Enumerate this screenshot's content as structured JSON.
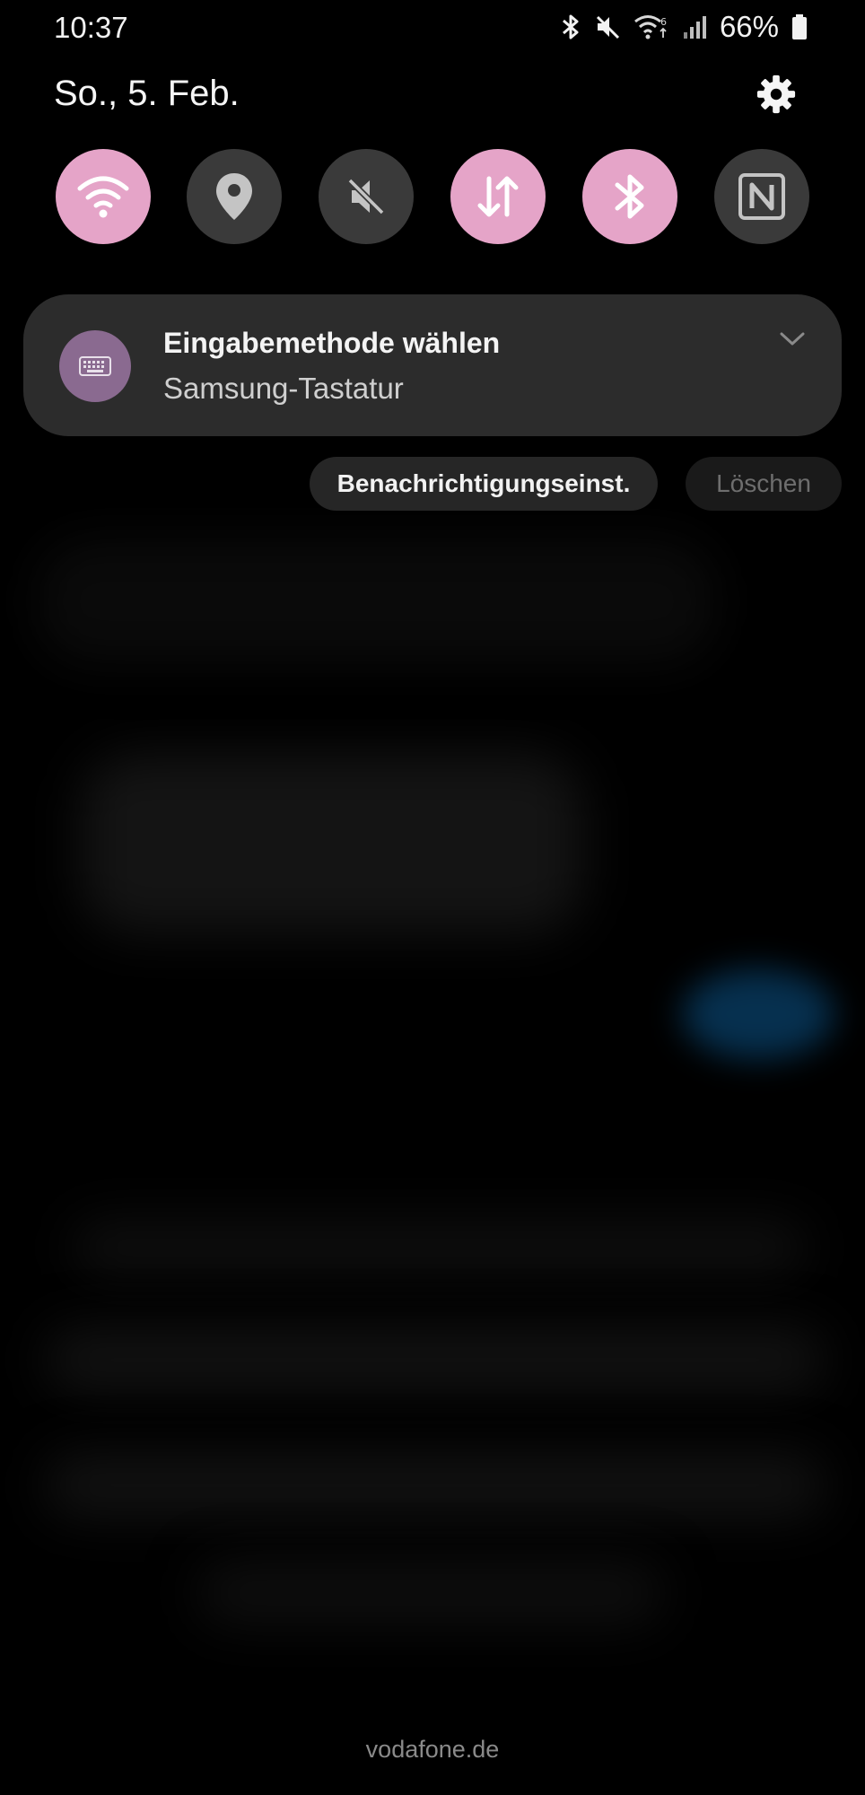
{
  "status_bar": {
    "time": "10:37",
    "battery": "66%",
    "icons": [
      "bluetooth-icon",
      "mute-icon",
      "wifi-6-icon",
      "signal-icon",
      "battery-icon"
    ]
  },
  "header": {
    "date": "So., 5. Feb.",
    "settings_icon": "gear-icon"
  },
  "quick_settings": [
    {
      "name": "wifi",
      "icon": "wifi-icon",
      "state": "on"
    },
    {
      "name": "location",
      "icon": "location-pin-icon",
      "state": "off"
    },
    {
      "name": "sound",
      "icon": "mute-icon",
      "state": "off"
    },
    {
      "name": "mobile-data",
      "icon": "data-arrows-icon",
      "state": "on"
    },
    {
      "name": "bluetooth",
      "icon": "bluetooth-icon",
      "state": "on"
    },
    {
      "name": "nfc",
      "icon": "nfc-icon",
      "state": "off"
    }
  ],
  "notification": {
    "icon": "keyboard-icon",
    "title": "Eingabemethode wählen",
    "subtitle": "Samsung-Tastatur"
  },
  "actions": {
    "settings_label": "Benachrichtigungseinst.",
    "clear_label": "Löschen"
  },
  "footer": {
    "carrier": "vodafone.de"
  },
  "colors": {
    "accent_on": "#e5a4c8",
    "toggle_off": "#3a3a3a",
    "card": "#2c2c2c",
    "notif_icon_bg": "#8a6a90"
  }
}
